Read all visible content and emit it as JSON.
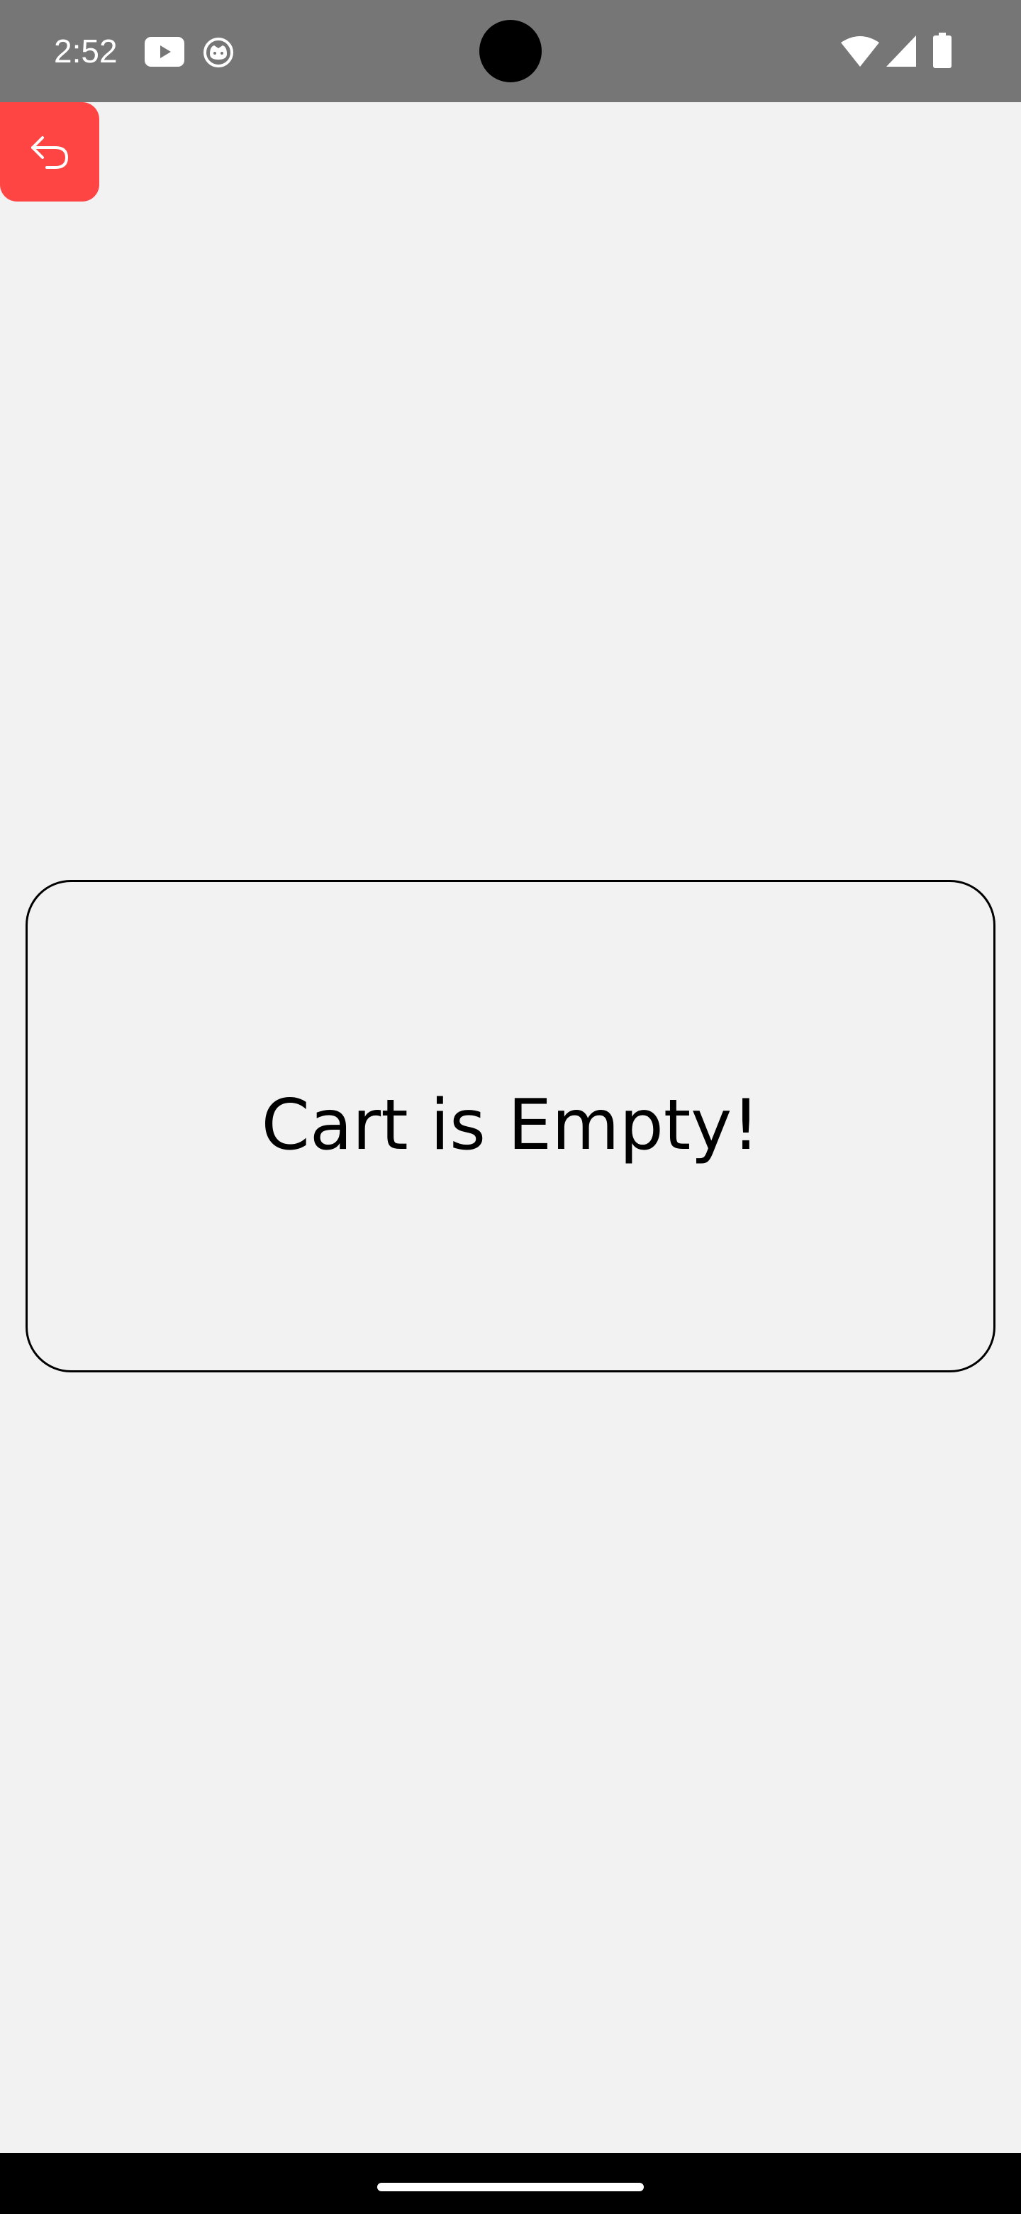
{
  "status_bar": {
    "time": "2:52",
    "icons": [
      "youtube-icon",
      "cat-icon",
      "wifi-icon",
      "signal-icon",
      "battery-icon"
    ]
  },
  "back_button": {
    "icon": "undo-arrow-icon",
    "color": "#ff4444"
  },
  "cart": {
    "empty_message": "Cart is Empty!"
  },
  "colors": {
    "background": "#f2f2f2",
    "status_bar": "#767676",
    "nav_bar": "#000000",
    "accent": "#ff4444"
  }
}
